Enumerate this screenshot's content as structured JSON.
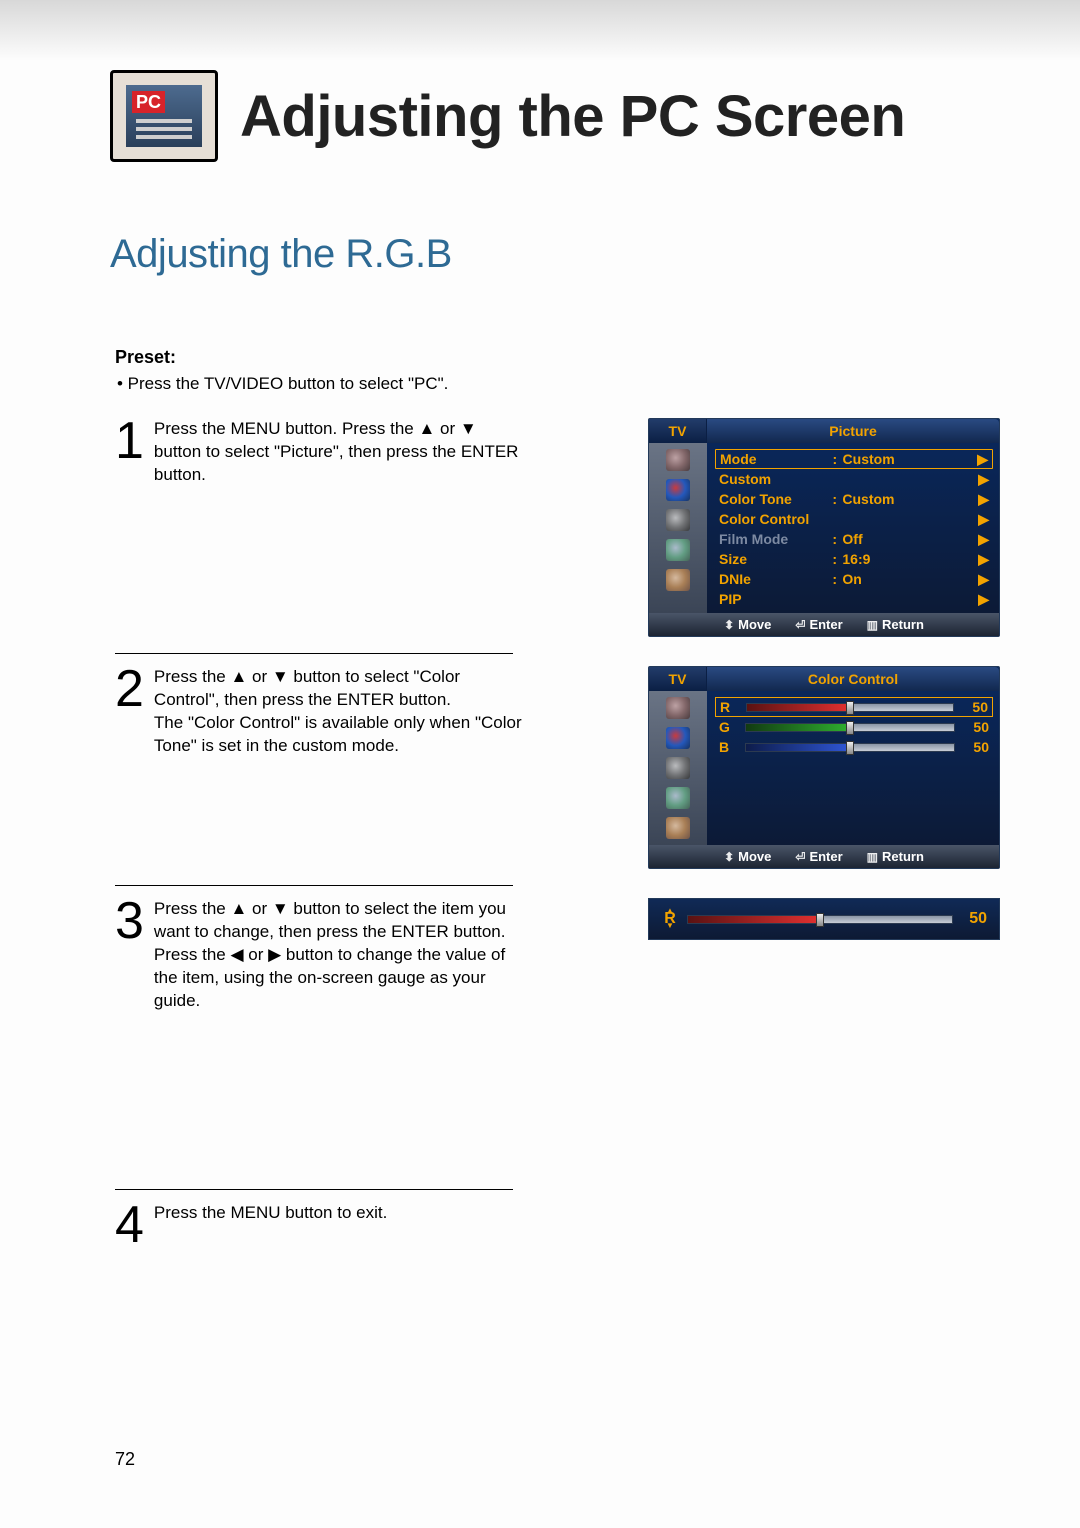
{
  "header": {
    "icon_badge": "PC",
    "title": "Adjusting the PC Screen"
  },
  "section_title": "Adjusting the R.G.B",
  "preset": {
    "label": "Preset:",
    "text": "•  Press the TV/VIDEO button to select \"PC\"."
  },
  "steps": {
    "s1_num": "1",
    "s1_text": "Press the MENU button. Press the ▲ or ▼ button to select \"Picture\", then press the ENTER button.",
    "s2_num": "2",
    "s2_text": "Press the ▲ or ▼ button to select \"Color Control\", then press the ENTER button.\nThe \"Color Control\" is available only when \"Color Tone\" is set in the custom mode.",
    "s3_num": "3",
    "s3_text": "Press the ▲ or ▼ button to select the item you want to change, then press the ENTER button.\nPress the ◀ or ▶ button to change the value of the item, using the on-screen gauge as your guide.",
    "s4_num": "4",
    "s4_text": "Press the MENU button to exit."
  },
  "osd1": {
    "tv": "TV",
    "title": "Picture",
    "rows": [
      {
        "label": "Mode",
        "colon": ":",
        "value": "Custom",
        "arrow": "▶",
        "highlight": true
      },
      {
        "label": "Custom",
        "colon": "",
        "value": "",
        "arrow": "▶"
      },
      {
        "label": "Color Tone",
        "colon": ":",
        "value": "Custom",
        "arrow": "▶"
      },
      {
        "label": "Color Control",
        "colon": "",
        "value": "",
        "arrow": "▶"
      },
      {
        "label": "Film Mode",
        "colon": ":",
        "value": "Off",
        "arrow": "▶",
        "dim": true
      },
      {
        "label": "Size",
        "colon": ":",
        "value": "16:9",
        "arrow": "▶"
      },
      {
        "label": "DNIe",
        "colon": ":",
        "value": "On",
        "arrow": "▶"
      },
      {
        "label": "PIP",
        "colon": "",
        "value": "",
        "arrow": "▶"
      }
    ],
    "footer": {
      "move": "Move",
      "enter": "Enter",
      "return": "Return"
    }
  },
  "osd2": {
    "tv": "TV",
    "title": "Color Control",
    "sliders": [
      {
        "letter": "R",
        "value": "50",
        "highlight": true,
        "fill": "r"
      },
      {
        "letter": "G",
        "value": "50",
        "fill": "g"
      },
      {
        "letter": "B",
        "value": "50",
        "fill": "b"
      }
    ],
    "footer": {
      "move": "Move",
      "enter": "Enter",
      "return": "Return"
    }
  },
  "osd3": {
    "letter": "R",
    "value": "50"
  },
  "page_number": "72",
  "symbols": {
    "updown": "⬍",
    "enter": "⏎",
    "return": "▥"
  }
}
